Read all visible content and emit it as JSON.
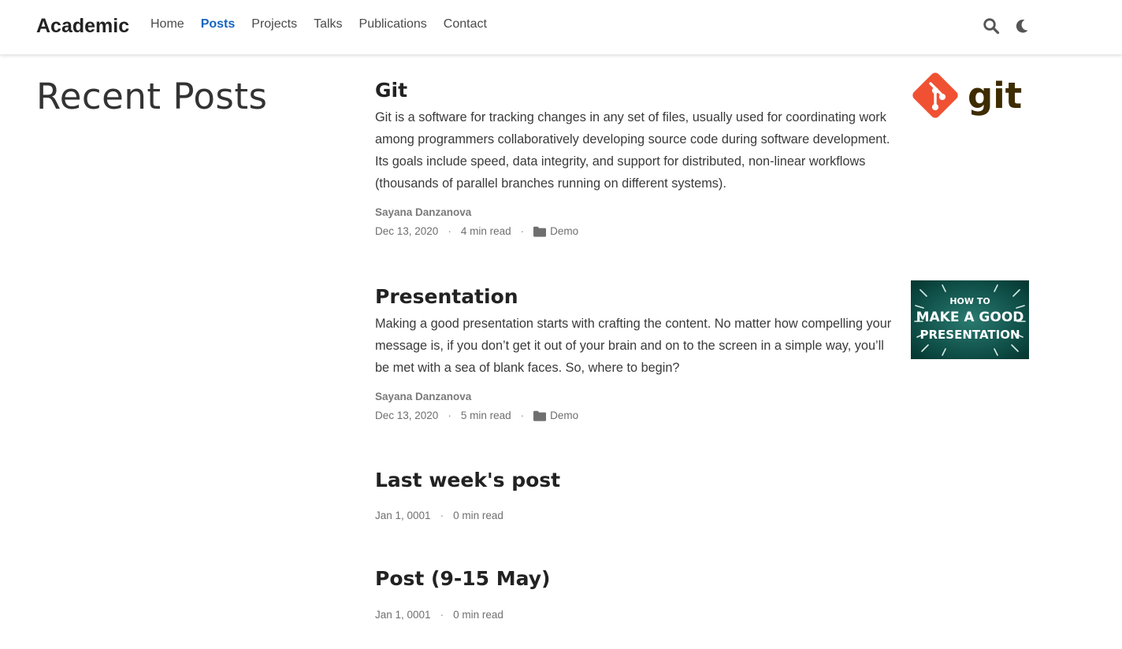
{
  "header": {
    "brand": "Academic",
    "nav": [
      {
        "label": "Home",
        "active": false
      },
      {
        "label": "Posts",
        "active": true
      },
      {
        "label": "Projects",
        "active": false
      },
      {
        "label": "Talks",
        "active": false
      },
      {
        "label": "Publications",
        "active": false
      },
      {
        "label": "Contact",
        "active": false
      }
    ],
    "icons": [
      "search-icon",
      "moon-icon"
    ],
    "accent_color": "#1565c0"
  },
  "page": {
    "title": "Recent Posts"
  },
  "posts": [
    {
      "title": "Git",
      "summary": "Git is a software for tracking changes in any set of files, usually used for coordinating work among programmers collaboratively developing source code during software development. Its goals include speed, data integrity, and support for distributed, non-linear workflows (thousands of parallel branches running on different systems).",
      "author": "Sayana Danzanova",
      "date": "Dec 13, 2020",
      "read_time": "4 min read",
      "category": "Demo",
      "thumbnail": {
        "type": "git-logo",
        "logo_text": "git",
        "logo_color": "#f05133",
        "text_color": "#3e2c00"
      }
    },
    {
      "title": "Presentation",
      "summary": "Making a good presentation starts with crafting the content. No matter how compelling your message is, if you don’t get it out of your brain and on to the screen in a simple way, you’ll be met with a sea of blank faces. So, where to begin?",
      "author": "Sayana Danzanova",
      "date": "Dec 13, 2020",
      "read_time": "5 min read",
      "category": "Demo",
      "thumbnail": {
        "type": "presentation-image",
        "lines": [
          "HOW TO",
          "MAKE A GOOD",
          "PRESENTATION"
        ],
        "bg_color": "#0c4f48"
      }
    },
    {
      "title": "Last week's post",
      "date": "Jan 1, 0001",
      "read_time": "0 min read"
    },
    {
      "title": "Post (9-15 May)",
      "date": "Jan 1, 0001",
      "read_time": "0 min read"
    }
  ],
  "meta_separator": "·"
}
